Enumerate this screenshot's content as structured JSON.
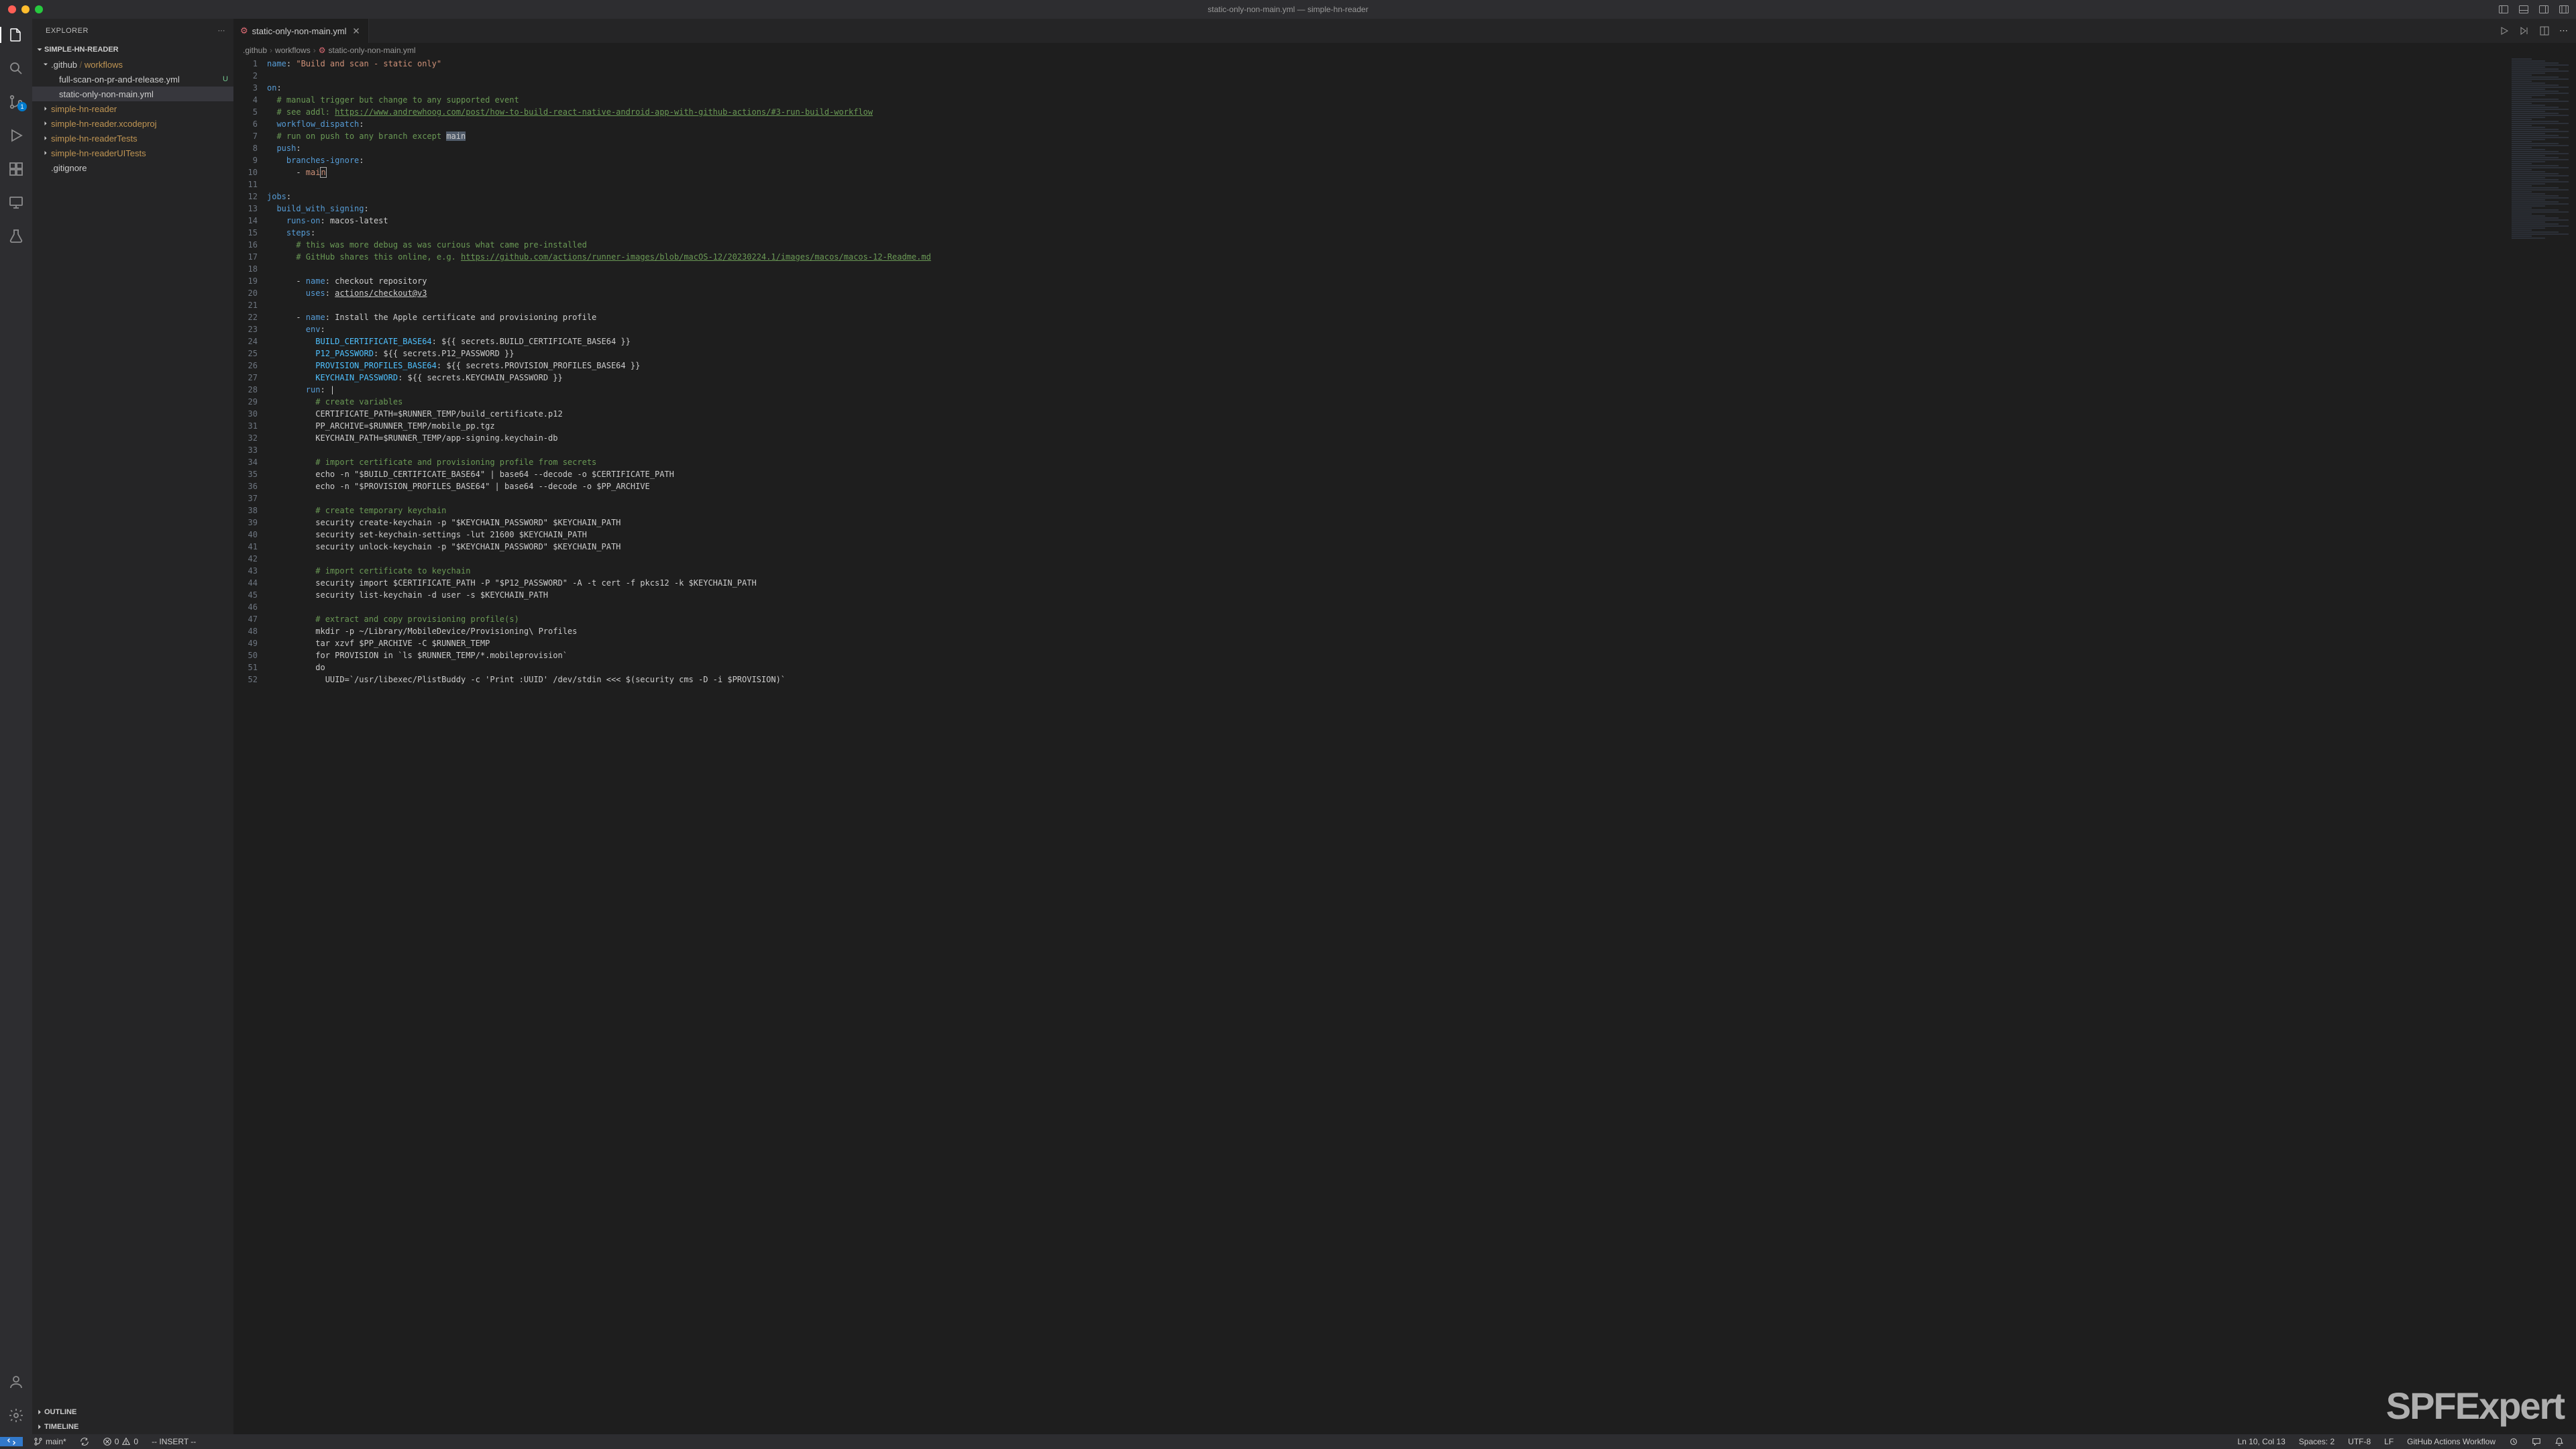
{
  "window": {
    "title": "static-only-non-main.yml — simple-hn-reader"
  },
  "explorer": {
    "title": "EXPLORER",
    "project": "SIMPLE-HN-READER",
    "tree": [
      {
        "label": ".github / workflows",
        "indent": 1,
        "type": "folder-open",
        "path": true
      },
      {
        "label": "full-scan-on-pr-and-release.yml",
        "indent": 2,
        "type": "file",
        "git": "U"
      },
      {
        "label": "static-only-non-main.yml",
        "indent": 2,
        "type": "file",
        "selected": true,
        "git": "dot"
      },
      {
        "label": "simple-hn-reader",
        "indent": 1,
        "type": "folder"
      },
      {
        "label": "simple-hn-reader.xcodeproj",
        "indent": 1,
        "type": "folder"
      },
      {
        "label": "simple-hn-readerTests",
        "indent": 1,
        "type": "folder"
      },
      {
        "label": "simple-hn-readerUITests",
        "indent": 1,
        "type": "folder"
      },
      {
        "label": ".gitignore",
        "indent": 1,
        "type": "file"
      }
    ],
    "outline": "OUTLINE",
    "timeline": "TIMELINE"
  },
  "tab": {
    "name": "static-only-non-main.yml",
    "dirty": true
  },
  "breadcrumb": [
    ".github",
    "workflows",
    "static-only-non-main.yml"
  ],
  "statusbar": {
    "branch": "main*",
    "sync": "",
    "errors": "0",
    "warnings": "0",
    "mode": "-- INSERT --",
    "cursor": "Ln 10, Col 13",
    "spaces": "Spaces: 2",
    "encoding": "UTF-8",
    "eol": "LF",
    "language": "GitHub Actions Workflow"
  },
  "scm_badge": "1",
  "code": [
    {
      "n": 1,
      "html": "<span class='tok-key'>name</span>: <span class='tok-str'>\"Build and scan - static only\"</span>"
    },
    {
      "n": 2,
      "html": ""
    },
    {
      "n": 3,
      "html": "<span class='tok-key'>on</span>:"
    },
    {
      "n": 4,
      "html": "  <span class='tok-cmt'># manual trigger but change to any supported event</span>"
    },
    {
      "n": 5,
      "html": "  <span class='tok-cmt'># see addl: </span><span class='tok-link'>https://www.andrewhoog.com/post/how-to-build-react-native-android-app-with-github-actions/#3-run-build-workflow</span>"
    },
    {
      "n": 6,
      "html": "  <span class='tok-key'>workflow_dispatch</span>:"
    },
    {
      "n": 7,
      "html": "  <span class='tok-cmt'># run on push to any branch except </span><span class='tok-sel'>main</span>"
    },
    {
      "n": 8,
      "html": "  <span class='tok-key'>push</span>:"
    },
    {
      "n": 9,
      "html": "    <span class='tok-key'>branches-ignore</span>:"
    },
    {
      "n": 10,
      "html": "      - <span class='tok-str'>mai</span><span class='cursor-box tok-str'>n</span>",
      "current": true
    },
    {
      "n": 11,
      "html": ""
    },
    {
      "n": 12,
      "html": "<span class='tok-key'>jobs</span>:"
    },
    {
      "n": 13,
      "html": "  <span class='tok-key'>build_with_signing</span>:"
    },
    {
      "n": 14,
      "html": "    <span class='tok-key'>runs-on</span>: macos-latest"
    },
    {
      "n": 15,
      "html": "    <span class='tok-key'>steps</span>:"
    },
    {
      "n": 16,
      "html": "      <span class='tok-cmt'># this was more debug as was curious what came pre-installed</span>"
    },
    {
      "n": 17,
      "html": "      <span class='tok-cmt'># GitHub shares this online, e.g. </span><span class='tok-link'>https://github.com/actions/runner-images/blob/macOS-12/20230224.1/images/macos/macos-12-Readme.md</span>"
    },
    {
      "n": 18,
      "html": ""
    },
    {
      "n": 19,
      "html": "      - <span class='tok-key'>name</span>: checkout repository"
    },
    {
      "n": 20,
      "html": "        <span class='tok-key'>uses</span>: <span style='text-decoration:underline'>actions/checkout@v3</span>"
    },
    {
      "n": 21,
      "html": ""
    },
    {
      "n": 22,
      "html": "      - <span class='tok-key'>name</span>: Install the Apple certificate and provisioning profile"
    },
    {
      "n": 23,
      "html": "        <span class='tok-key'>env</span>:"
    },
    {
      "n": 24,
      "html": "          <span class='tok-const'>BUILD_CERTIFICATE_BASE64</span>: ${{ secrets.BUILD_CERTIFICATE_BASE64 }}"
    },
    {
      "n": 25,
      "html": "          <span class='tok-const'>P12_PASSWORD</span>: ${{ secrets.P12_PASSWORD }}"
    },
    {
      "n": 26,
      "html": "          <span class='tok-const'>PROVISION_PROFILES_BASE64</span>: ${{ secrets.PROVISION_PROFILES_BASE64 }}"
    },
    {
      "n": 27,
      "html": "          <span class='tok-const'>KEYCHAIN_PASSWORD</span>: ${{ secrets.KEYCHAIN_PASSWORD }}"
    },
    {
      "n": 28,
      "html": "        <span class='tok-key'>run</span>: |"
    },
    {
      "n": 29,
      "html": "          <span class='tok-cmt'># create variables</span>"
    },
    {
      "n": 30,
      "html": "          CERTIFICATE_PATH=$RUNNER_TEMP/build_certificate.p12"
    },
    {
      "n": 31,
      "html": "          PP_ARCHIVE=$RUNNER_TEMP/mobile_pp.tgz"
    },
    {
      "n": 32,
      "html": "          KEYCHAIN_PATH=$RUNNER_TEMP/app-signing.keychain-db"
    },
    {
      "n": 33,
      "html": ""
    },
    {
      "n": 34,
      "html": "          <span class='tok-cmt'># import certificate and provisioning profile from secrets</span>"
    },
    {
      "n": 35,
      "html": "          echo -n \"$BUILD_CERTIFICATE_BASE64\" | base64 --decode -o $CERTIFICATE_PATH"
    },
    {
      "n": 36,
      "html": "          echo -n \"$PROVISION_PROFILES_BASE64\" | base64 --decode -o $PP_ARCHIVE"
    },
    {
      "n": 37,
      "html": ""
    },
    {
      "n": 38,
      "html": "          <span class='tok-cmt'># create temporary keychain</span>"
    },
    {
      "n": 39,
      "html": "          security create-keychain -p \"$KEYCHAIN_PASSWORD\" $KEYCHAIN_PATH"
    },
    {
      "n": 40,
      "html": "          security set-keychain-settings -lut 21600 $KEYCHAIN_PATH"
    },
    {
      "n": 41,
      "html": "          security unlock-keychain -p \"$KEYCHAIN_PASSWORD\" $KEYCHAIN_PATH"
    },
    {
      "n": 42,
      "html": ""
    },
    {
      "n": 43,
      "html": "          <span class='tok-cmt'># import certificate to keychain</span>"
    },
    {
      "n": 44,
      "html": "          security import $CERTIFICATE_PATH -P \"$P12_PASSWORD\" -A -t cert -f pkcs12 -k $KEYCHAIN_PATH"
    },
    {
      "n": 45,
      "html": "          security list-keychain -d user -s $KEYCHAIN_PATH"
    },
    {
      "n": 46,
      "html": ""
    },
    {
      "n": 47,
      "html": "          <span class='tok-cmt'># extract and copy provisioning profile(s)</span>"
    },
    {
      "n": 48,
      "html": "          mkdir -p ~/Library/MobileDevice/Provisioning\\ Profiles"
    },
    {
      "n": 49,
      "html": "          tar xzvf $PP_ARCHIVE -C $RUNNER_TEMP"
    },
    {
      "n": 50,
      "html": "          for PROVISION in `ls $RUNNER_TEMP/*.mobileprovision`"
    },
    {
      "n": 51,
      "html": "          do"
    },
    {
      "n": 52,
      "html": "            UUID=`/usr/libexec/PlistBuddy -c 'Print :UUID' /dev/stdin &lt;&lt;&lt; $(security cms -D -i $PROVISION)`"
    }
  ],
  "watermark": "SPFExpert"
}
